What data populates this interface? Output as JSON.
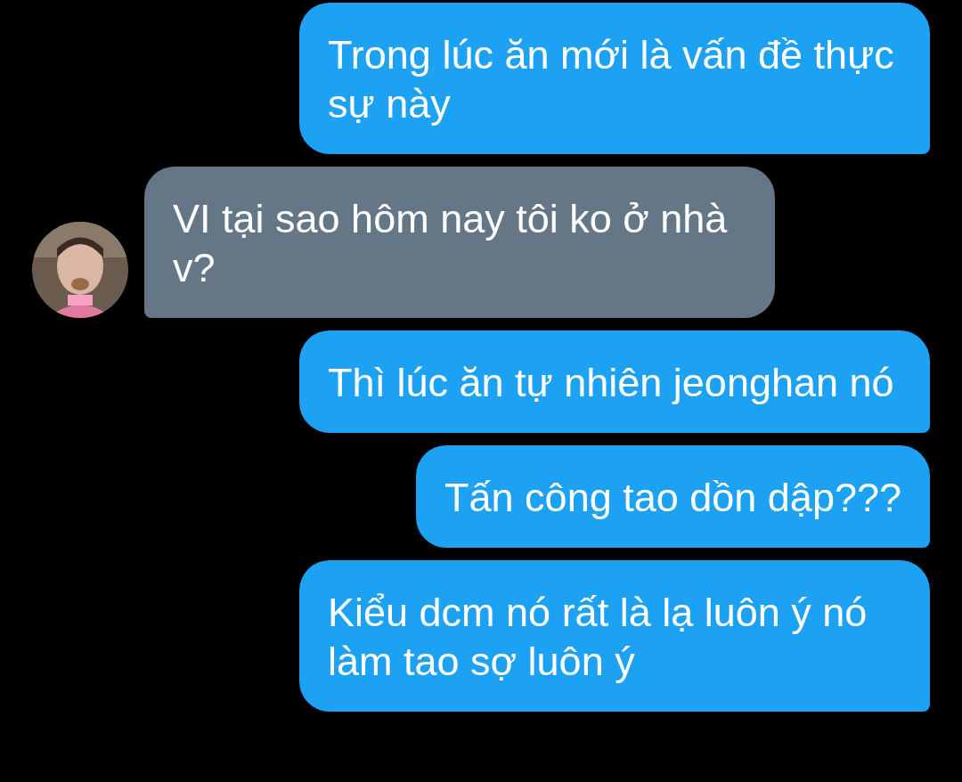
{
  "messages": [
    {
      "kind": "sent",
      "text": "Trong lúc ăn mới là vấn đề thực sự này"
    },
    {
      "kind": "received",
      "text": "VI tại sao hôm nay tôi ko ở nhà v?"
    },
    {
      "kind": "sent",
      "text": "Thì lúc ăn tự nhiên jeonghan nó"
    },
    {
      "kind": "sent",
      "text": "Tấn công tao dồn dập???"
    },
    {
      "kind": "sent",
      "text": "Kiểu dcm nó rất là lạ luôn ý nó làm tao sợ luôn ý"
    }
  ]
}
